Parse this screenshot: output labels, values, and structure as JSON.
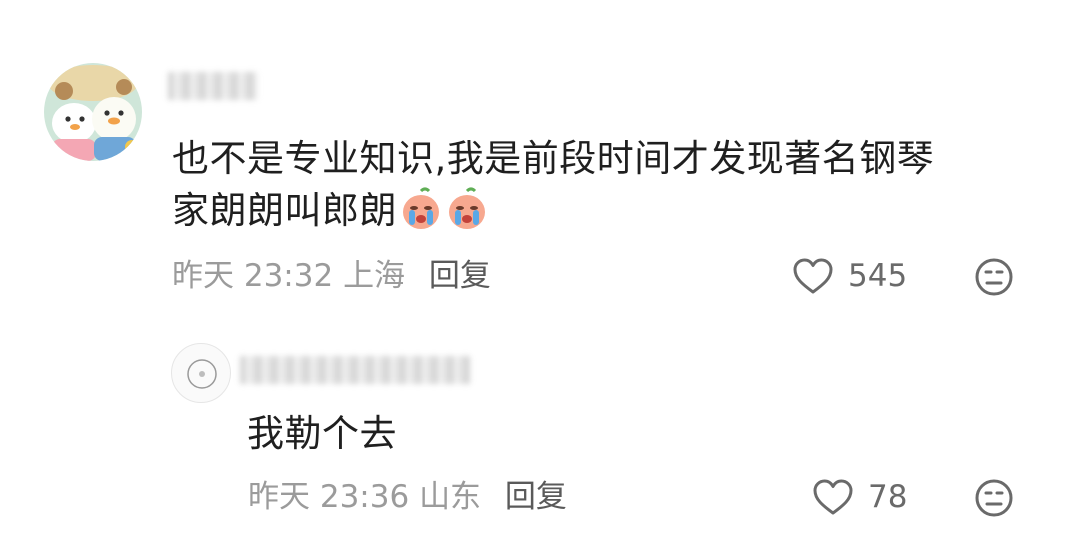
{
  "comments": [
    {
      "text_line1": "也不是专业知识,我是前段时间才发现著名钢琴",
      "text_line2": "家朗朗叫郎朗",
      "emoji": [
        "crying-emoji",
        "crying-emoji"
      ],
      "time": "昨天 23:32",
      "location": "上海",
      "reply_label": "回复",
      "likes": "545"
    },
    {
      "text": "我勒个去",
      "time": "昨天 23:36",
      "location": "山东",
      "reply_label": "回复",
      "likes": "78"
    }
  ],
  "colors": {
    "text": "#1f1f1f",
    "meta": "#9b9b9b",
    "icon": "#6a6a6a"
  }
}
